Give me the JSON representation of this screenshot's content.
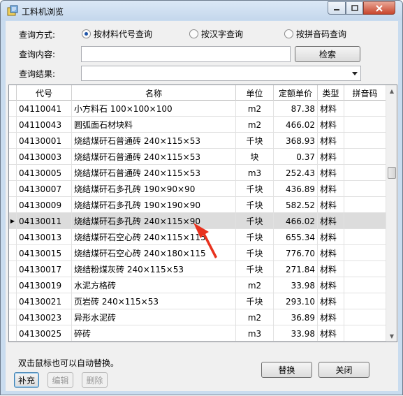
{
  "window": {
    "title": "工料机浏览"
  },
  "query": {
    "mode_label": "查询方式:",
    "modes": [
      {
        "label": "按材料代号查询",
        "checked": true
      },
      {
        "label": "按汉字查询",
        "checked": false
      },
      {
        "label": "按拼音码查询",
        "checked": false
      }
    ],
    "content_label": "查询内容:",
    "content_value": "",
    "search_button": "检索",
    "result_label": "查询结果:",
    "result_value": ""
  },
  "table": {
    "columns": [
      "代号",
      "名称",
      "单位",
      "定额单价",
      "类型",
      "拼音码"
    ],
    "rows": [
      {
        "code": "04110041",
        "name": "小方料石 100×100×100",
        "unit": "m2",
        "price": "87.38",
        "type": "材料",
        "pinyin": ""
      },
      {
        "code": "04110043",
        "name": "圆弧面石材块料",
        "unit": "m2",
        "price": "466.02",
        "type": "材料",
        "pinyin": ""
      },
      {
        "code": "04130001",
        "name": "烧结煤矸石普通砖 240×115×53",
        "unit": "千块",
        "price": "368.93",
        "type": "材料",
        "pinyin": ""
      },
      {
        "code": "04130003",
        "name": "烧结煤矸石普通砖 240×115×53",
        "unit": "块",
        "price": "0.37",
        "type": "材料",
        "pinyin": ""
      },
      {
        "code": "04130005",
        "name": "烧结煤矸石普通砖 240×115×53",
        "unit": "m3",
        "price": "252.43",
        "type": "材料",
        "pinyin": ""
      },
      {
        "code": "04130007",
        "name": "烧结煤矸石多孔砖 190×90×90",
        "unit": "千块",
        "price": "436.89",
        "type": "材料",
        "pinyin": ""
      },
      {
        "code": "04130009",
        "name": "烧结煤矸石多孔砖 190×190×90",
        "unit": "千块",
        "price": "582.52",
        "type": "材料",
        "pinyin": ""
      },
      {
        "code": "04130011",
        "name": "烧结煤矸石多孔砖 240×115×90",
        "unit": "千块",
        "price": "466.02",
        "type": "材料",
        "pinyin": "",
        "selected": true
      },
      {
        "code": "04130013",
        "name": "烧结煤矸石空心砖 240×115×115",
        "unit": "千块",
        "price": "655.34",
        "type": "材料",
        "pinyin": ""
      },
      {
        "code": "04130015",
        "name": "烧结煤矸石空心砖 240×180×115",
        "unit": "千块",
        "price": "776.70",
        "type": "材料",
        "pinyin": ""
      },
      {
        "code": "04130017",
        "name": "烧结粉煤灰砖 240×115×53",
        "unit": "千块",
        "price": "271.84",
        "type": "材料",
        "pinyin": ""
      },
      {
        "code": "04130019",
        "name": "水泥方格砖",
        "unit": "m2",
        "price": "33.98",
        "type": "材料",
        "pinyin": ""
      },
      {
        "code": "04130021",
        "name": "页岩砖 240×115×53",
        "unit": "千块",
        "price": "293.10",
        "type": "材料",
        "pinyin": ""
      },
      {
        "code": "04130023",
        "name": "异形水泥砖",
        "unit": "m2",
        "price": "36.89",
        "type": "材料",
        "pinyin": ""
      },
      {
        "code": "04130025",
        "name": "碎砖",
        "unit": "m3",
        "price": "33.98",
        "type": "材料",
        "pinyin": ""
      }
    ]
  },
  "footer": {
    "hint": "双击鼠标也可以自动替换。",
    "replace_button": "替换",
    "close_button": "关闭",
    "supplement_button": "补充",
    "edit_button": "编辑",
    "delete_button": "删除"
  },
  "colors": {
    "annotation_arrow": "#e8321e",
    "selection": "#dcdcdc"
  }
}
